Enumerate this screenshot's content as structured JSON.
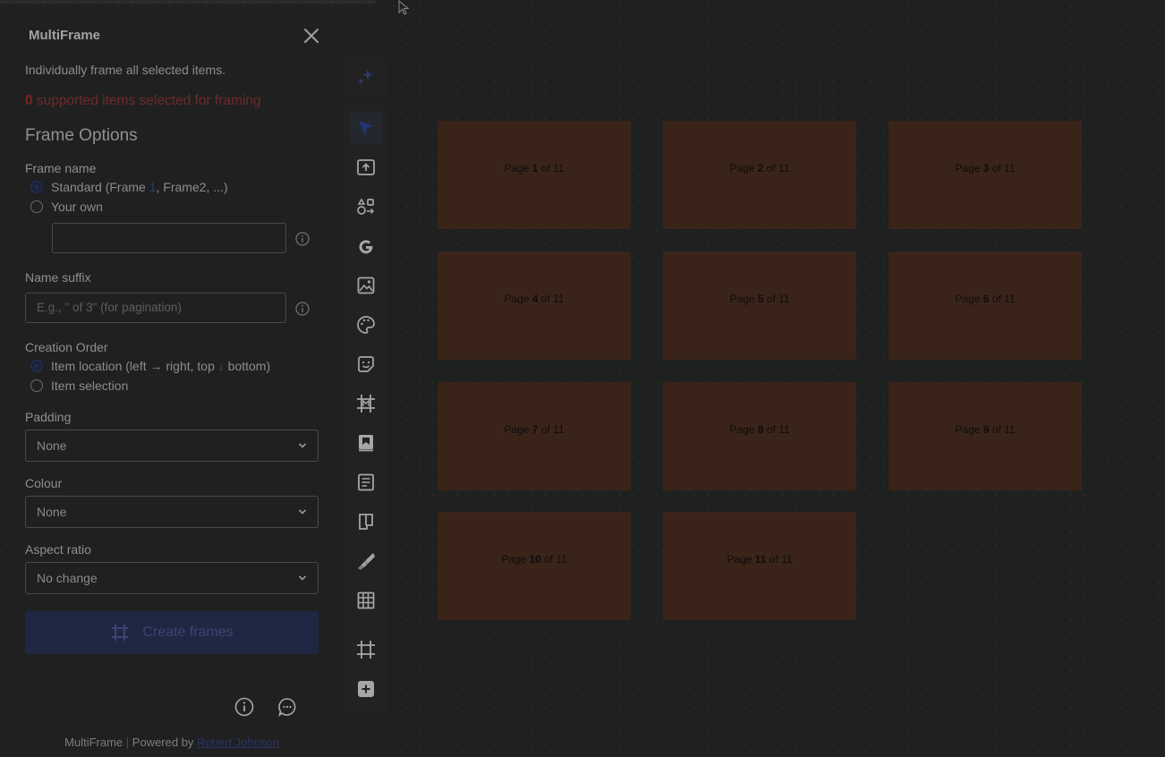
{
  "panel": {
    "title": "MultiFrame",
    "description": "Individually frame all selected items.",
    "selected_count": "0",
    "selected_text": " supported items selected for framing",
    "section_title": "Frame Options",
    "frame_name": {
      "label": "Frame name",
      "option_standard_prefix": "Standard (Frame ",
      "option_standard_num": "1",
      "option_standard_suffix": ", Frame2, ...)",
      "option_own": "Your own",
      "own_value": ""
    },
    "name_suffix": {
      "label": "Name suffix",
      "placeholder": "E.g., \" of 3\" (for pagination)"
    },
    "creation_order": {
      "label": "Creation Order",
      "option_location_a": "Item location (left ",
      "arrow_right": "→",
      "option_location_b": " right, top ",
      "arrow_down": "↓",
      "option_location_c": " bottom)",
      "option_selection": "Item selection"
    },
    "padding": {
      "label": "Padding",
      "value": "None"
    },
    "colour": {
      "label": "Colour",
      "value": "None"
    },
    "aspect_ratio": {
      "label": "Aspect ratio",
      "value": "No change"
    },
    "create_button": "Create frames",
    "credit_app": "MultiFrame",
    "credit_sep": " | ",
    "credit_powered": "Powered by ",
    "credit_author": "Robert Johnson"
  },
  "toolbar": {
    "icons": [
      "ai-sparkle-icon",
      "select-arrow-icon",
      "upload-icon",
      "shapes-icon",
      "google-icon",
      "image-icon",
      "palette-icon",
      "sticker-icon",
      "frame-m-icon",
      "book-icon",
      "doc-icon",
      "kanban-icon",
      "jira-icon",
      "table-icon",
      "frame-icon",
      "add-icon"
    ]
  },
  "canvas": {
    "pages": [
      {
        "pre": "Page ",
        "num": "1",
        "post": " of 11"
      },
      {
        "pre": "Page ",
        "num": "2",
        "post": " of 11"
      },
      {
        "pre": "Page ",
        "num": "3",
        "post": " of 11"
      },
      {
        "pre": "Page ",
        "num": "4",
        "post": " of 11"
      },
      {
        "pre": "Page ",
        "num": "5",
        "post": " of 11"
      },
      {
        "pre": "Page ",
        "num": "6",
        "post": " of 11"
      },
      {
        "pre": "Page ",
        "num": "7",
        "post": " of 11"
      },
      {
        "pre": "Page ",
        "num": "8",
        "post": " of 11"
      },
      {
        "pre": "Page ",
        "num": "9",
        "post": " of 11"
      },
      {
        "pre": "Page ",
        "num": "10",
        "post": " of 11"
      },
      {
        "pre": "Page ",
        "num": "11",
        "post": " of 11"
      }
    ]
  },
  "colors": {
    "overlay_bg": "#1f2020",
    "card": "#3a2419",
    "accent": "#1d2956",
    "warning": "#6d2a2a"
  }
}
